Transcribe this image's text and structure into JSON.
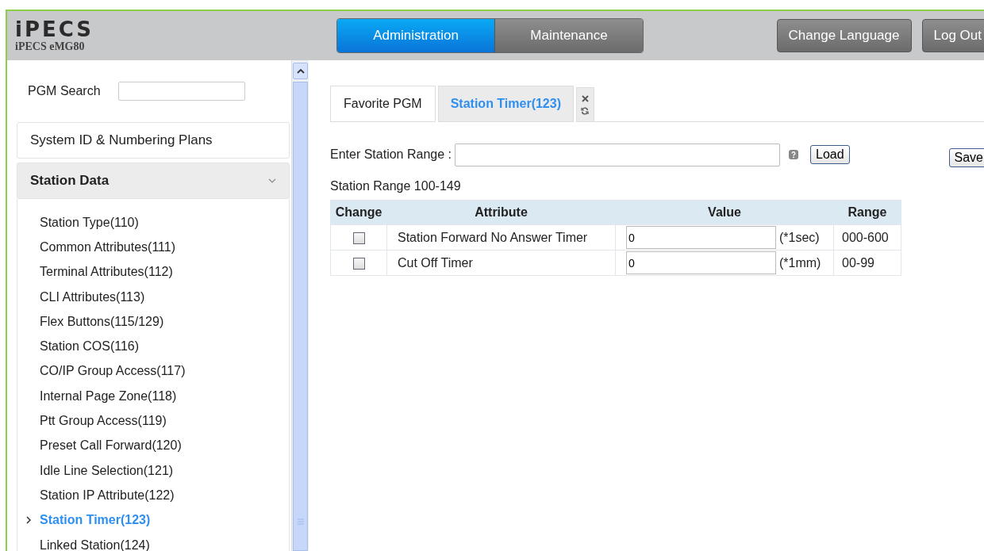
{
  "header": {
    "logo": "iPECS",
    "product": "iPECS eMG80",
    "nav_tabs": [
      {
        "label": "Administration",
        "selected": true
      },
      {
        "label": "Maintenance",
        "selected": false
      }
    ],
    "buttons": [
      "Change Language",
      "Log Out"
    ]
  },
  "sidebar": {
    "search": {
      "label": "PGM Search"
    },
    "sections": [
      {
        "label": "System ID & Numbering Plans",
        "expanded": false
      },
      {
        "label": "Station Data",
        "expanded": true
      }
    ],
    "items": [
      {
        "label": "Station Type(110)",
        "selected": false
      },
      {
        "label": "Common Attributes(111)",
        "selected": false
      },
      {
        "label": "Terminal Attributes(112)",
        "selected": false
      },
      {
        "label": "CLI Attributes(113)",
        "selected": false
      },
      {
        "label": "Flex Buttons(115/129)",
        "selected": false
      },
      {
        "label": "Station COS(116)",
        "selected": false
      },
      {
        "label": "CO/IP Group Access(117)",
        "selected": false
      },
      {
        "label": "Internal Page Zone(118)",
        "selected": false
      },
      {
        "label": "Ptt Group Access(119)",
        "selected": false
      },
      {
        "label": "Preset Call Forward(120)",
        "selected": false
      },
      {
        "label": "Idle Line Selection(121)",
        "selected": false
      },
      {
        "label": "Station IP Attribute(122)",
        "selected": false
      },
      {
        "label": "Station Timer(123)",
        "selected": true
      },
      {
        "label": "Linked Station(124)",
        "selected": false
      }
    ]
  },
  "content": {
    "tabs": [
      {
        "label": "Favorite PGM",
        "selected": false
      },
      {
        "label": "Station Timer(123)",
        "selected": true
      }
    ],
    "range_field": {
      "label": "Enter Station Range :"
    },
    "load_button": "Load",
    "save_button": "Save",
    "range_caption": "Station Range 100-149",
    "table": {
      "columns": [
        "Change",
        "Attribute",
        "Value",
        "Range"
      ],
      "rows": [
        {
          "checked": false,
          "attribute": "Station Forward No Answer Timer",
          "value": "0",
          "unit": "(*1sec)",
          "range": "000-600"
        },
        {
          "checked": false,
          "attribute": "Cut Off Timer",
          "value": "0",
          "unit": "(*1mm)",
          "range": "00-99"
        }
      ]
    }
  }
}
